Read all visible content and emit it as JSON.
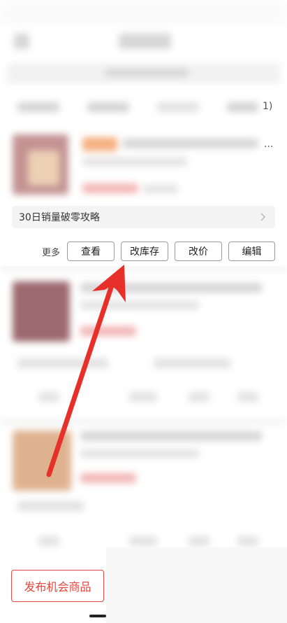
{
  "tab_row": {
    "truncated_tail": "1)"
  },
  "list": {
    "truncated_title_tail": "..."
  },
  "strategy": {
    "label": "30日销量破零攻略",
    "chevron_icon": "chevron-right-icon"
  },
  "actions": {
    "more_label": "更多",
    "buttons": [
      {
        "label": "查看"
      },
      {
        "label": "改库存"
      },
      {
        "label": "改价"
      },
      {
        "label": "编辑"
      }
    ]
  },
  "footer": {
    "publish_label": "发布机会商品"
  },
  "colors": {
    "accent": "#e8453c",
    "annotation_arrow": "#e8302a",
    "button_border": "#9a9a9a",
    "strategy_bg": "#f4f4f4"
  }
}
